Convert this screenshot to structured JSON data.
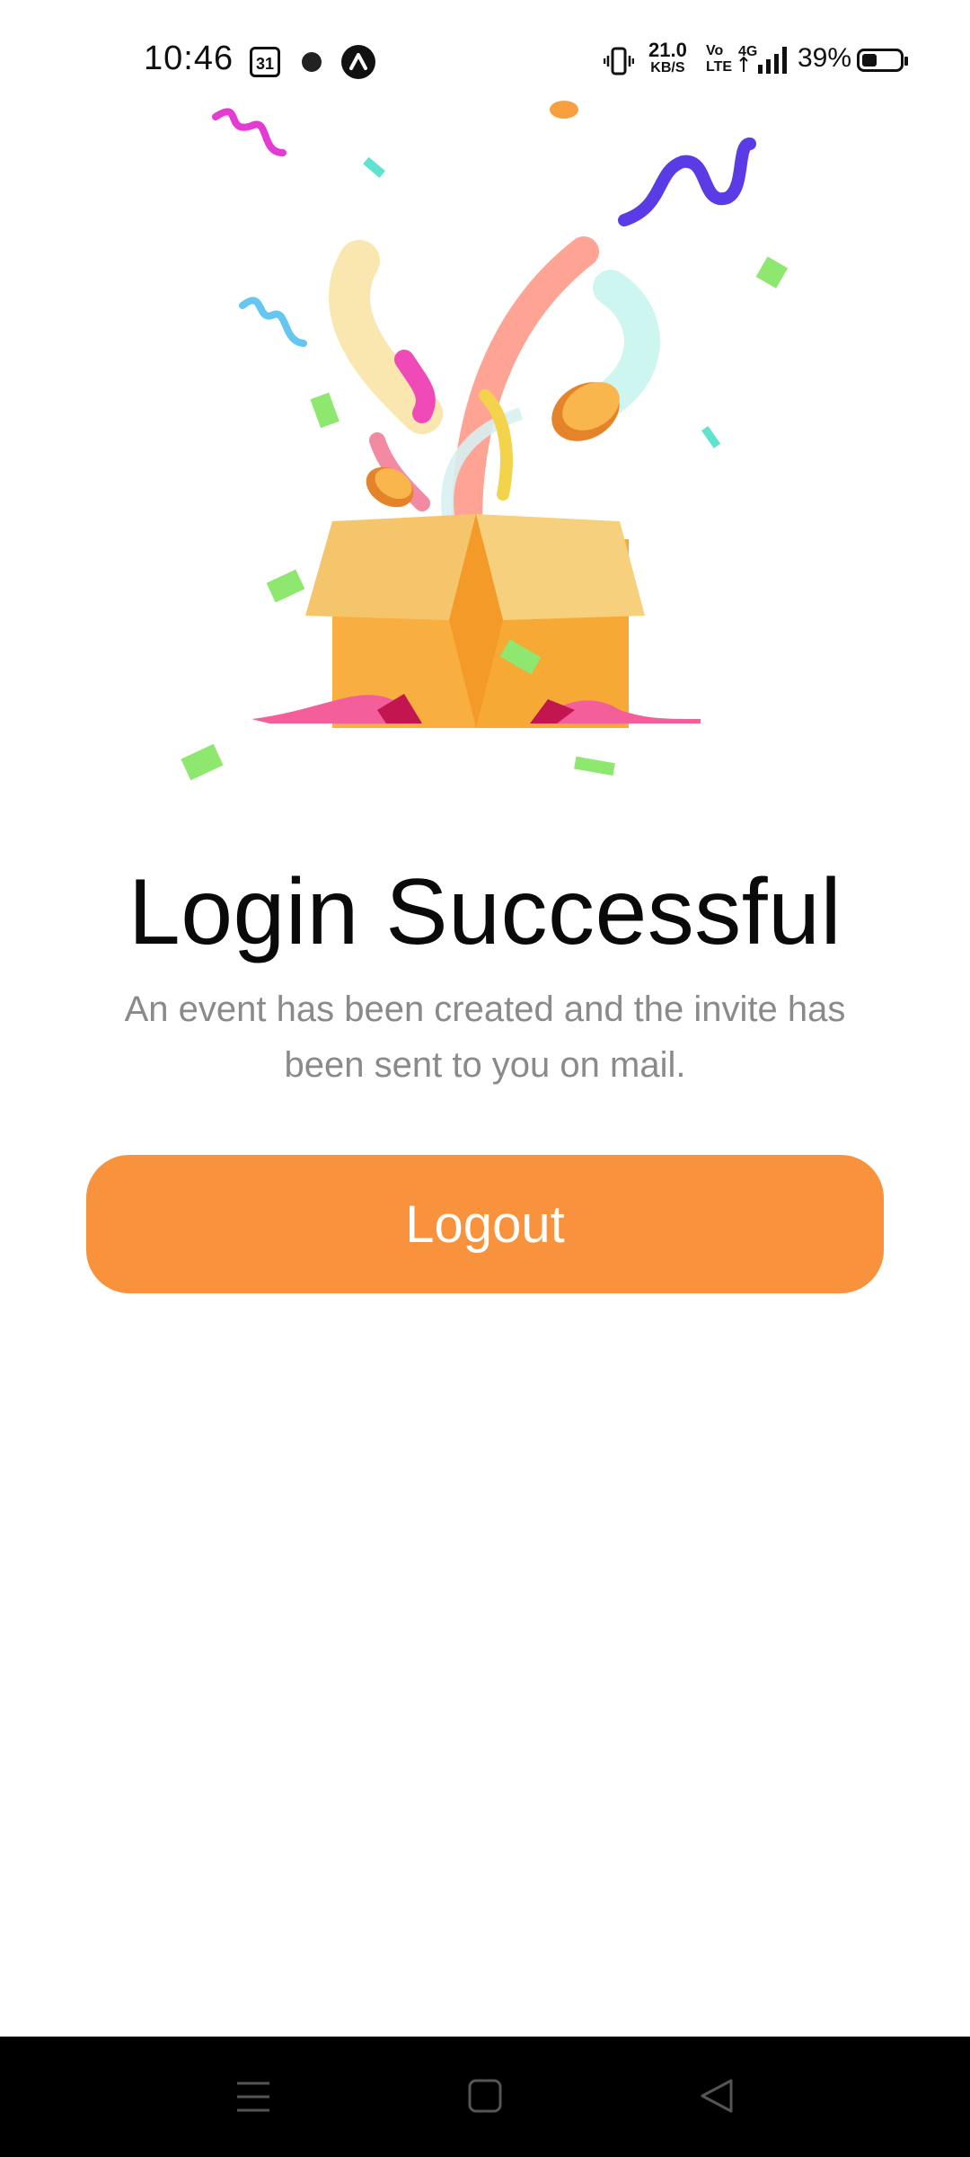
{
  "status_bar": {
    "time": "10:46",
    "calendar_day": "31",
    "speed_value": "21.0",
    "speed_unit": "KB/S",
    "volte_top": "Vo",
    "volte_bottom": "LTE",
    "network": "4G",
    "battery_percent": "39%",
    "battery_level": 0.39
  },
  "main": {
    "title": "Login Successful",
    "subtitle": "An event has been created and the invite has been sent to you on mail.",
    "logout_label": "Logout"
  },
  "navigation": {
    "icons": [
      "menu-icon",
      "home-square-icon",
      "back-triangle-icon"
    ]
  },
  "colors": {
    "accent": "#f9923c",
    "title": "#0a0a0a",
    "subtitle": "#8a8a8a",
    "navbar": "#000000"
  }
}
